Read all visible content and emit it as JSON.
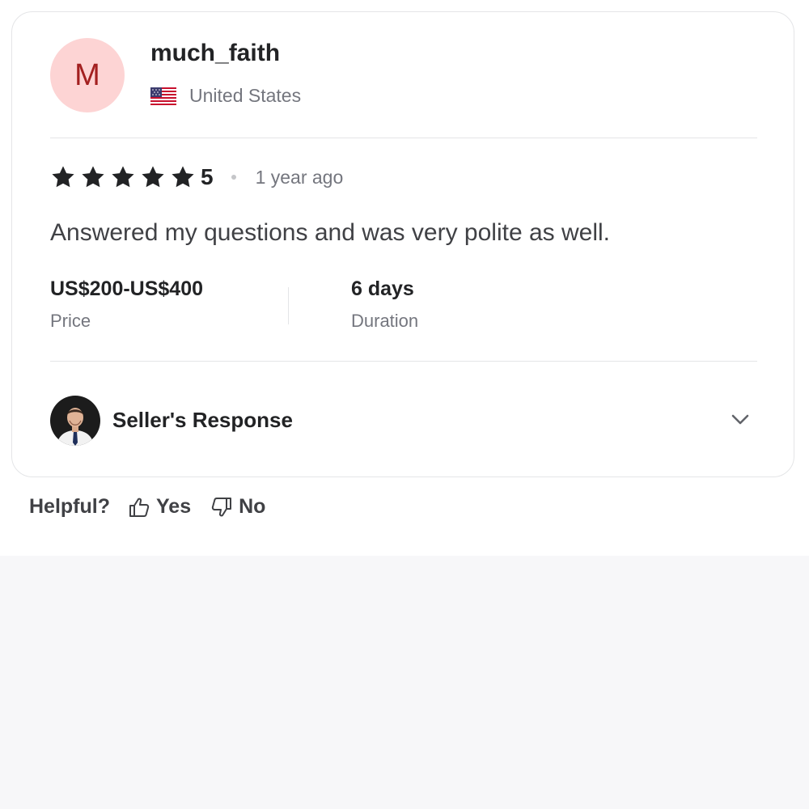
{
  "review": {
    "avatar_initial": "M",
    "username": "much_faith",
    "country": "United States",
    "flag_icon": "us-flag-icon",
    "rating": "5",
    "stars_count": 5,
    "time_ago": "1 year ago",
    "text": "Answered my questions and was very polite as well.",
    "price": {
      "value": "US$200-US$400",
      "label": "Price"
    },
    "duration": {
      "value": "6 days",
      "label": "Duration"
    },
    "seller_response_label": "Seller's Response",
    "expand_icon": "chevron-down-icon"
  },
  "helpful": {
    "label": "Helpful?",
    "yes_label": "Yes",
    "no_label": "No",
    "yes_icon": "thumbs-up-icon",
    "no_icon": "thumbs-down-icon"
  },
  "colors": {
    "avatar_bg": "#fdd4d4",
    "avatar_text": "#a32020",
    "text_primary": "#222325",
    "text_secondary": "#74767e",
    "border": "#e4e5e7",
    "page_bg": "#f7f7f9"
  }
}
